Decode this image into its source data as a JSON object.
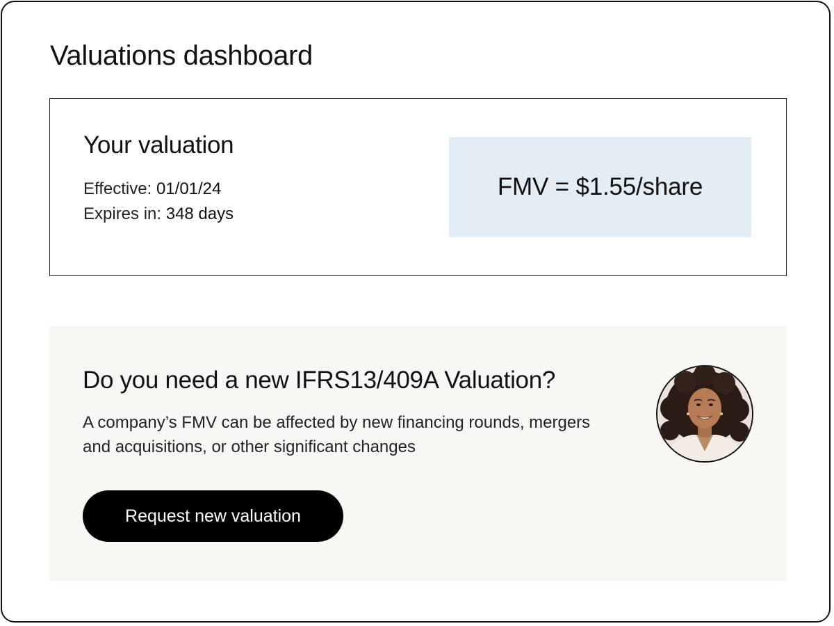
{
  "page": {
    "title": "Valuations dashboard"
  },
  "valuation_card": {
    "heading": "Your valuation",
    "effective_label": "Effective:",
    "effective_value": "01/01/24",
    "expires_label": "Expires in:",
    "expires_value": "348 days",
    "fmv_text": "FMV = $1.55/share"
  },
  "promo": {
    "heading": "Do you need a new IFRS13/409A Valuation?",
    "body": "A company’s FMV can be affected by new financing rounds, mergers and acquisitions, or other significant changes",
    "button_label": "Request new valuation",
    "avatar_icon": "person-photo"
  },
  "colors": {
    "fmv_background": "#e3edf3",
    "promo_background": "#f9f7f3",
    "button_background": "#000000",
    "button_text": "#ffffff"
  }
}
